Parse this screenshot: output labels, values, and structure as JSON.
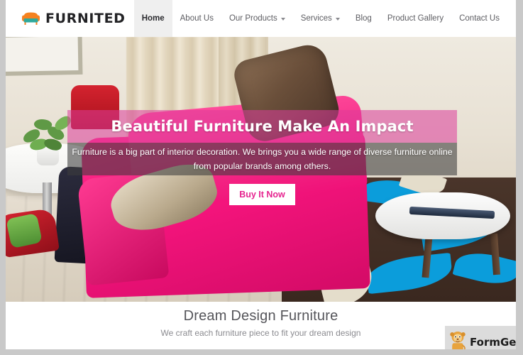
{
  "site": {
    "brand_name": "FURNITED",
    "logo_icon": "sofa-icon",
    "accent_color": "#f58220",
    "logo_teal": "#2fa99b",
    "hero_band_pink": "#dd3d9a",
    "cta_text_color": "#e6238f"
  },
  "nav": {
    "items": [
      {
        "label": "Home",
        "active": true,
        "has_dropdown": false
      },
      {
        "label": "About Us",
        "active": false,
        "has_dropdown": false
      },
      {
        "label": "Our Products",
        "active": false,
        "has_dropdown": true
      },
      {
        "label": "Services",
        "active": false,
        "has_dropdown": true
      },
      {
        "label": "Blog",
        "active": false,
        "has_dropdown": false
      },
      {
        "label": "Product Gallery",
        "active": false,
        "has_dropdown": false
      },
      {
        "label": "Contact Us",
        "active": false,
        "has_dropdown": false
      }
    ]
  },
  "hero": {
    "heading": "Beautiful Furniture Make An Impact",
    "subtext": "Furniture is a big part of interior decoration. We brings you a wide range of diverse furniture online from popular brands among others.",
    "cta_label": "Buy It Now"
  },
  "promo": {
    "title": "Dream Design Furniture",
    "subtitle": "We craft each furniture piece to fit your dream design"
  },
  "watermark": {
    "label": "FormGet",
    "icon": "lion-mascot-icon"
  }
}
